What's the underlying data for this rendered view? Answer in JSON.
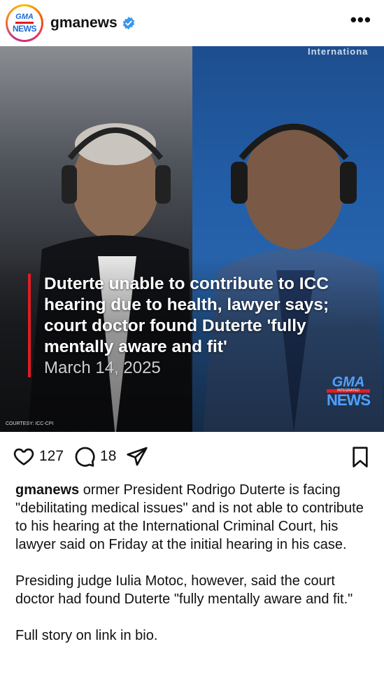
{
  "post": {
    "username": "gmanews",
    "avatar": {
      "top": "GMA",
      "bottom": "NEWS"
    },
    "verified": true,
    "more_label": "•••",
    "image": {
      "headline": "Duterte unable to contribute to ICC hearing due to health, lawyer says; court doctor found Duterte 'fully mentally aware and fit'",
      "date": "March 14, 2025",
      "courtesy": "COURTESY: ICC-CPI",
      "bg_text": "Internationa",
      "watermark": {
        "top": "GMA",
        "sub": "INTEGRATED",
        "bottom": "NEWS"
      }
    },
    "likes": "127",
    "comments": "18",
    "caption": {
      "user": "gmanews",
      "paragraphs": [
        "ormer President Rodrigo Duterte is facing \"debilitating medical issues\" and is not able to contribute to his hearing at the International Criminal Court, his lawyer said on Friday at the initial hearing in his case.",
        "Presiding judge Iulia Motoc, however, said the court doctor had found Duterte \"fully mentally aware and fit.\"",
        "Full story on link in bio."
      ]
    }
  },
  "colors": {
    "accent_red": "#e31b23",
    "verified_blue": "#3897f0"
  }
}
